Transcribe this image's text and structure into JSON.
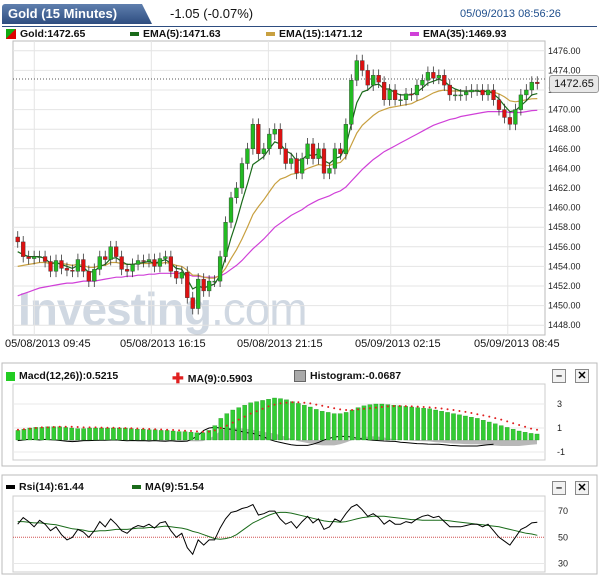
{
  "header": {
    "instrument": "Gold (15 Minutes)",
    "change": "-1.05 (-0.07%)",
    "datetime": "05/09/2013 08:56:26"
  },
  "price_panel": {
    "legend": [
      {
        "label": "Gold:1472.65",
        "color": "#cc0000"
      },
      {
        "label": "EMA(5):1471.63",
        "color": "#1a6b1a"
      },
      {
        "label": "EMA(15):1471.12",
        "color": "#c8a040"
      },
      {
        "label": "EMA(35):1469.93",
        "color": "#d040d8"
      }
    ],
    "last_price": "1472.65",
    "watermark_a": "Investing",
    "watermark_b": ".com",
    "x_labels": [
      "05/08/2013 09:45",
      "05/08/2013 16:15",
      "05/08/2013 21:15",
      "05/09/2013 02:15",
      "05/09/2013 08:45"
    ]
  },
  "macd_panel": {
    "legend": [
      {
        "label": "Macd(12,26)):0.5215",
        "color": "#22cc22"
      },
      {
        "label": "MA(9):0.5903",
        "color": "#e02020"
      },
      {
        "label": "Histogram:-0.0687",
        "color": "#999999"
      }
    ]
  },
  "rsi_panel": {
    "legend": [
      {
        "label": "Rsi(14):61.44",
        "color": "#000000"
      },
      {
        "label": "MA(9):51.54",
        "color": "#1a6b1a"
      }
    ]
  },
  "buttons": {
    "minimize": "–",
    "close": "✕"
  },
  "chart_data": [
    {
      "type": "candlestick",
      "title": "Gold (15 Minutes)",
      "ylim": [
        1447,
        1477
      ],
      "y_ticks": [
        1448,
        1450,
        1452,
        1454,
        1456,
        1458,
        1460,
        1462,
        1464,
        1466,
        1468,
        1470,
        1472,
        1474,
        1476
      ],
      "close": [
        1456.5,
        1455.0,
        1454.8,
        1455.0,
        1455.0,
        1454.5,
        1453.5,
        1454.6,
        1453.8,
        1453.6,
        1453.5,
        1454.7,
        1453.5,
        1452.5,
        1453.7,
        1455.0,
        1454.7,
        1456.0,
        1455.0,
        1453.7,
        1453.5,
        1454.2,
        1454.6,
        1454.5,
        1454.7,
        1454.0,
        1454.8,
        1455.0,
        1453.5,
        1452.8,
        1453.4,
        1450.8,
        1449.7,
        1452.7,
        1451.5,
        1452.5,
        1452.5,
        1455.0,
        1458.5,
        1461.0,
        1462.0,
        1464.5,
        1466.0,
        1468.5,
        1465.5,
        1466.0,
        1467.5,
        1468.0,
        1466.0,
        1464.5,
        1465.0,
        1463.5,
        1465.0,
        1466.5,
        1465.0,
        1466.0,
        1463.5,
        1464.0,
        1466.0,
        1465.5,
        1468.5,
        1473.0,
        1475.0,
        1474.0,
        1472.5,
        1473.5,
        1472.8,
        1471.0,
        1472.0,
        1471.0,
        1471.0,
        1471.6,
        1471.5,
        1472.5,
        1473.0,
        1473.8,
        1473.2,
        1473.5,
        1472.5,
        1471.5,
        1471.5,
        1471.5,
        1471.8,
        1472.0,
        1472.0,
        1471.5,
        1472.0,
        1471.0,
        1470.0,
        1469.2,
        1468.5,
        1470.0,
        1471.5,
        1472.0,
        1472.8,
        1472.65
      ],
      "ema5": [
        1455.5,
        1455.2,
        1455.0,
        1455.0,
        1455.0,
        1454.8,
        1454.3,
        1454.4,
        1454.2,
        1454.0,
        1453.8,
        1454.1,
        1453.9,
        1453.4,
        1453.5,
        1454.0,
        1454.2,
        1454.8,
        1454.9,
        1454.5,
        1454.2,
        1454.2,
        1454.3,
        1454.4,
        1454.5,
        1454.3,
        1454.5,
        1454.7,
        1454.3,
        1453.8,
        1453.7,
        1452.7,
        1451.7,
        1452.0,
        1451.8,
        1452.0,
        1452.2,
        1453.1,
        1454.9,
        1456.9,
        1458.6,
        1460.6,
        1462.4,
        1464.4,
        1464.8,
        1465.2,
        1466.0,
        1466.7,
        1466.5,
        1465.8,
        1465.5,
        1464.8,
        1464.9,
        1465.4,
        1465.3,
        1465.5,
        1464.8,
        1464.5,
        1465.0,
        1465.2,
        1466.3,
        1468.5,
        1470.7,
        1471.8,
        1472.0,
        1472.5,
        1472.6,
        1472.1,
        1472.1,
        1471.7,
        1471.5,
        1471.5,
        1471.5,
        1471.8,
        1472.2,
        1472.7,
        1472.9,
        1473.1,
        1472.9,
        1472.4,
        1472.1,
        1471.9,
        1471.9,
        1471.9,
        1471.9,
        1471.8,
        1471.9,
        1471.6,
        1471.1,
        1470.4,
        1469.8,
        1469.9,
        1470.4,
        1470.9,
        1471.5,
        1471.63
      ],
      "ema15": [
        1454.0,
        1454.1,
        1454.2,
        1454.3,
        1454.4,
        1454.4,
        1454.3,
        1454.3,
        1454.3,
        1454.2,
        1454.1,
        1454.2,
        1454.1,
        1453.9,
        1453.9,
        1454.1,
        1454.1,
        1454.4,
        1454.4,
        1454.3,
        1454.2,
        1454.2,
        1454.3,
        1454.3,
        1454.3,
        1454.3,
        1454.3,
        1454.4,
        1454.3,
        1454.1,
        1454.0,
        1453.6,
        1453.1,
        1453.1,
        1452.9,
        1452.8,
        1452.8,
        1453.1,
        1453.8,
        1454.8,
        1455.7,
        1456.8,
        1458.0,
        1459.3,
        1460.1,
        1460.8,
        1461.6,
        1462.4,
        1462.9,
        1463.1,
        1463.4,
        1463.5,
        1463.7,
        1464.0,
        1464.2,
        1464.4,
        1464.3,
        1464.3,
        1464.5,
        1464.6,
        1465.2,
        1466.4,
        1467.6,
        1468.4,
        1468.9,
        1469.4,
        1469.8,
        1470.0,
        1470.2,
        1470.3,
        1470.4,
        1470.5,
        1470.6,
        1470.9,
        1471.1,
        1471.4,
        1471.7,
        1471.9,
        1472.0,
        1471.9,
        1471.9,
        1471.9,
        1471.9,
        1471.9,
        1471.9,
        1471.9,
        1471.9,
        1471.8,
        1471.6,
        1471.3,
        1470.9,
        1470.8,
        1470.9,
        1471.0,
        1471.1,
        1471.12
      ],
      "ema35": [
        1451.0,
        1451.2,
        1451.4,
        1451.6,
        1451.8,
        1451.9,
        1452.0,
        1452.1,
        1452.2,
        1452.3,
        1452.3,
        1452.4,
        1452.5,
        1452.5,
        1452.5,
        1452.6,
        1452.7,
        1452.8,
        1452.9,
        1452.9,
        1453.0,
        1453.0,
        1453.1,
        1453.1,
        1453.2,
        1453.2,
        1453.3,
        1453.3,
        1453.3,
        1453.3,
        1453.3,
        1453.2,
        1453.0,
        1453.0,
        1452.9,
        1452.9,
        1452.9,
        1453.0,
        1453.3,
        1453.7,
        1454.1,
        1454.6,
        1455.2,
        1455.8,
        1456.3,
        1456.8,
        1457.4,
        1458.0,
        1458.4,
        1458.8,
        1459.2,
        1459.5,
        1459.8,
        1460.2,
        1460.5,
        1460.8,
        1461.0,
        1461.2,
        1461.5,
        1461.7,
        1462.1,
        1462.7,
        1463.3,
        1463.9,
        1464.4,
        1464.9,
        1465.3,
        1465.7,
        1466.0,
        1466.3,
        1466.6,
        1466.9,
        1467.2,
        1467.5,
        1467.8,
        1468.1,
        1468.4,
        1468.6,
        1468.8,
        1469.0,
        1469.1,
        1469.3,
        1469.4,
        1469.5,
        1469.6,
        1469.7,
        1469.8,
        1469.8,
        1469.8,
        1469.8,
        1469.7,
        1469.7,
        1469.7,
        1469.8,
        1469.9,
        1469.93
      ],
      "x_labels": [
        "05/08/2013 09:45",
        "05/08/2013 16:15",
        "05/08/2013 21:15",
        "05/09/2013 02:15",
        "05/09/2013 08:45"
      ]
    },
    {
      "type": "bar",
      "name": "MACD",
      "ylim": [
        -1.5,
        4.5
      ],
      "y_ticks": [
        3,
        1,
        -1
      ],
      "macd": [
        0.8,
        0.9,
        1.0,
        1.05,
        1.05,
        1.1,
        1.1,
        1.1,
        1.05,
        1.0,
        0.95,
        0.95,
        1.0,
        1.0,
        1.0,
        1.0,
        1.0,
        1.0,
        1.0,
        0.95,
        0.9,
        0.9,
        0.85,
        0.85,
        0.8,
        0.8,
        0.75,
        0.7,
        0.7,
        0.65,
        0.6,
        0.6,
        0.8,
        1.2,
        1.8,
        2.2,
        2.5,
        2.7,
        2.9,
        3.1,
        3.2,
        3.3,
        3.4,
        3.5,
        3.45,
        3.35,
        3.2,
        3.05,
        2.9,
        2.75,
        2.55,
        2.4,
        2.3,
        2.2,
        2.2,
        2.3,
        2.5,
        2.7,
        2.85,
        2.95,
        3.0,
        3.0,
        2.95,
        2.9,
        2.85,
        2.8,
        2.75,
        2.7,
        2.65,
        2.6,
        2.5,
        2.4,
        2.3,
        2.2,
        2.1,
        2.0,
        1.9,
        1.8,
        1.65,
        1.5,
        1.35,
        1.2,
        1.05,
        0.9,
        0.75,
        0.65,
        0.55,
        0.5
      ],
      "signal": [
        0.85,
        0.9,
        0.95,
        1.0,
        1.05,
        1.05,
        1.08,
        1.1,
        1.1,
        1.1,
        1.08,
        1.05,
        1.05,
        1.05,
        1.03,
        1.02,
        1.02,
        1.0,
        0.99,
        0.98,
        0.96,
        0.94,
        0.92,
        0.9,
        0.88,
        0.85,
        0.83,
        0.8,
        0.77,
        0.75,
        0.72,
        0.69,
        0.7,
        0.8,
        1.0,
        1.2,
        1.45,
        1.7,
        1.95,
        2.2,
        2.4,
        2.6,
        2.8,
        2.95,
        3.05,
        3.1,
        3.15,
        3.15,
        3.1,
        3.05,
        2.95,
        2.85,
        2.75,
        2.65,
        2.55,
        2.5,
        2.5,
        2.55,
        2.6,
        2.65,
        2.7,
        2.75,
        2.8,
        2.82,
        2.83,
        2.82,
        2.8,
        2.78,
        2.75,
        2.72,
        2.68,
        2.62,
        2.56,
        2.5,
        2.42,
        2.34,
        2.25,
        2.15,
        2.05,
        1.95,
        1.82,
        1.7,
        1.55,
        1.4,
        1.25,
        1.1,
        0.95,
        0.85
      ],
      "histogram": [
        -0.05,
        0.0,
        0.05,
        0.05,
        0.0,
        0.05,
        0.02,
        0.0,
        -0.05,
        -0.1,
        -0.13,
        -0.1,
        -0.05,
        -0.05,
        -0.03,
        -0.02,
        -0.02,
        0.0,
        0.01,
        -0.03,
        -0.06,
        -0.04,
        -0.07,
        -0.05,
        -0.08,
        -0.05,
        -0.08,
        -0.1,
        -0.07,
        -0.1,
        -0.12,
        -0.09,
        0.1,
        0.4,
        0.8,
        1.0,
        1.05,
        1.0,
        0.95,
        0.9,
        0.8,
        0.7,
        0.6,
        0.55,
        0.4,
        0.25,
        0.05,
        -0.1,
        -0.2,
        -0.3,
        -0.4,
        -0.45,
        -0.45,
        -0.45,
        -0.35,
        -0.2,
        0.0,
        0.15,
        0.25,
        0.3,
        0.3,
        0.25,
        0.15,
        0.08,
        0.02,
        -0.02,
        -0.05,
        -0.08,
        -0.1,
        -0.12,
        -0.18,
        -0.22,
        -0.26,
        -0.3,
        -0.32,
        -0.34,
        -0.35,
        -0.35,
        -0.4,
        -0.45,
        -0.47,
        -0.5,
        -0.5,
        -0.5,
        -0.5,
        -0.45,
        -0.4,
        -0.35
      ]
    },
    {
      "type": "line",
      "name": "RSI",
      "ylim": [
        25,
        80
      ],
      "y_ticks": [
        70,
        50,
        30
      ],
      "rsi": [
        60,
        65,
        62,
        58,
        63,
        60,
        55,
        58,
        52,
        48,
        50,
        56,
        54,
        50,
        55,
        62,
        58,
        64,
        60,
        55,
        53,
        57,
        59,
        58,
        60,
        57,
        61,
        62,
        55,
        50,
        53,
        42,
        37,
        48,
        44,
        48,
        48,
        57,
        64,
        69,
        70,
        72,
        73,
        75,
        67,
        68,
        70,
        70,
        64,
        60,
        62,
        57,
        62,
        66,
        61,
        64,
        56,
        58,
        64,
        62,
        68,
        73,
        75,
        71,
        66,
        68,
        65,
        60,
        63,
        60,
        60,
        62,
        61,
        64,
        66,
        67,
        65,
        66,
        62,
        58,
        58,
        58,
        59,
        60,
        60,
        58,
        60,
        55,
        50,
        47,
        44,
        50,
        56,
        58,
        61,
        61.44
      ],
      "ma9": [
        62,
        62,
        61.5,
        61,
        61,
        60.5,
        60,
        59.5,
        58.5,
        57.5,
        56.5,
        56,
        55.5,
        54.5,
        54.5,
        55,
        55,
        55.5,
        56,
        56,
        56,
        56.5,
        57,
        57,
        57.5,
        57.5,
        58,
        58.5,
        58,
        57.5,
        57,
        56,
        54.5,
        53.5,
        52,
        50.5,
        49,
        48.5,
        49,
        50,
        52,
        55,
        58,
        61,
        63,
        65,
        67,
        68.5,
        69,
        69,
        68.5,
        67.5,
        66.5,
        65.5,
        64.5,
        63.5,
        62.5,
        62,
        62,
        61.5,
        62,
        63,
        64,
        65,
        65.5,
        66,
        66,
        66,
        65.5,
        65,
        64.5,
        64,
        63.5,
        63.5,
        63,
        63,
        63,
        63,
        63,
        62.5,
        62,
        61.5,
        61,
        60.5,
        60,
        59.5,
        59,
        58.5,
        58,
        57,
        56,
        55,
        54,
        53,
        52.5,
        51.54
      ]
    }
  ]
}
